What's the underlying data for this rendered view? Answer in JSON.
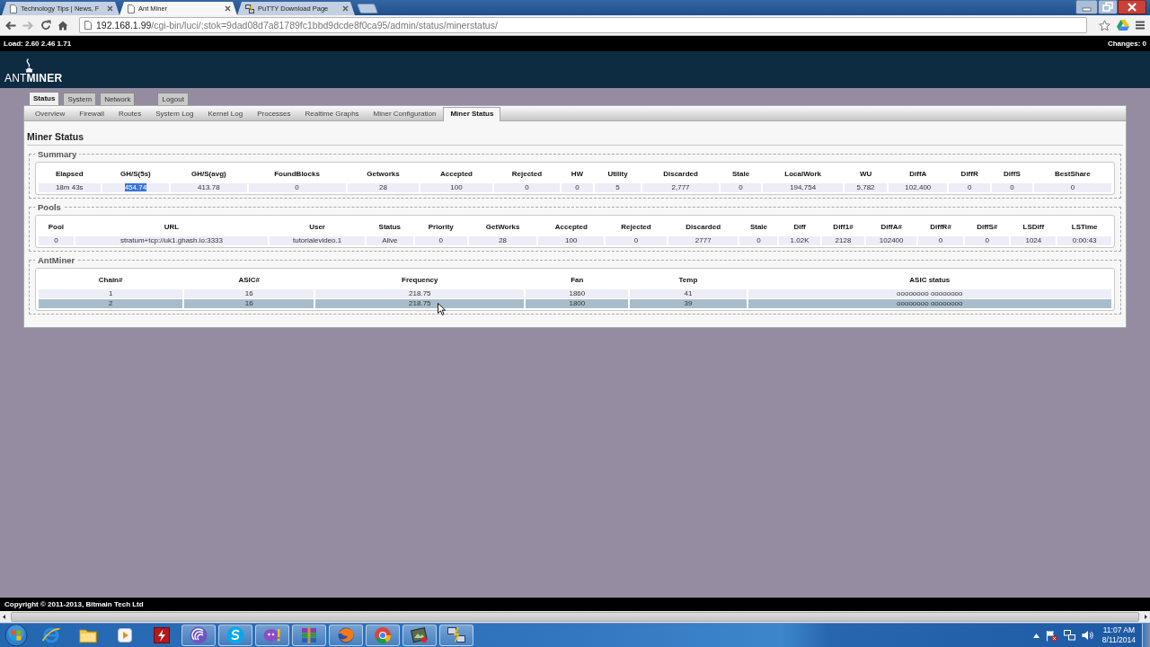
{
  "browser": {
    "tabs": [
      {
        "title": "Technology Tips | News, F",
        "selected": false,
        "kind": "page"
      },
      {
        "title": "Ant Miner",
        "selected": true,
        "kind": "page"
      },
      {
        "title": "PuTTY Download Page",
        "selected": false,
        "kind": "putty"
      }
    ],
    "back": {
      "disabled": false
    },
    "forward": {
      "disabled": true
    },
    "url_host": "192.168.1.99",
    "url_path": "/cgi-bin/luci/;stok=9dad08d7a81789fc1bbd9dcde8f0ca95/admin/status/minerstatus/"
  },
  "status_bar": {
    "load": "Load: 2.60 2.46 1.71",
    "changes": "Changes: 0"
  },
  "logo": "ANT**MINER**",
  "main_tabs": [
    {
      "label": "Status",
      "selected": true
    },
    {
      "label": "System",
      "selected": false
    },
    {
      "label": "Network",
      "selected": false
    }
  ],
  "logout": "Logout",
  "sub_tabs": [
    {
      "label": "Overview",
      "selected": false
    },
    {
      "label": "Firewall",
      "selected": false
    },
    {
      "label": "Routes",
      "selected": false
    },
    {
      "label": "System Log",
      "selected": false
    },
    {
      "label": "Kernel Log",
      "selected": false
    },
    {
      "label": "Processes",
      "selected": false
    },
    {
      "label": "Realtime Graphs",
      "selected": false
    },
    {
      "label": "Miner Configuration",
      "selected": false
    },
    {
      "label": "Miner Status",
      "selected": true
    }
  ],
  "page_title": "Miner Status",
  "sections": [
    {
      "legend": "Summary",
      "columns": [
        "Elapsed",
        "GH/S(5s)",
        "GH/S(avg)",
        "FoundBlocks",
        "Getworks",
        "Accepted",
        "Rejected",
        "HW",
        "Utility",
        "Discarded",
        "Stale",
        "LocalWork",
        "WU",
        "DiffA",
        "DiffR",
        "DiffS",
        "BestShare"
      ],
      "rows": [
        {
          "cells": [
            {
              "text": "18m 43s",
              "text_selected": false
            },
            {
              "text": "454.74",
              "text_selected": true
            },
            {
              "text": "413.78",
              "text_selected": false
            },
            {
              "text": "0",
              "text_selected": false
            },
            {
              "text": "28",
              "text_selected": false
            },
            {
              "text": "100",
              "text_selected": false
            },
            {
              "text": "0",
              "text_selected": false
            },
            {
              "text": "0",
              "text_selected": false
            },
            {
              "text": "5",
              "text_selected": false
            },
            {
              "text": "2,777",
              "text_selected": false
            },
            {
              "text": "0",
              "text_selected": false
            },
            {
              "text": "194,754",
              "text_selected": false
            },
            {
              "text": "5,782",
              "text_selected": false
            },
            {
              "text": "102,400",
              "text_selected": false
            },
            {
              "text": "0",
              "text_selected": false
            },
            {
              "text": "0",
              "text_selected": false
            },
            {
              "text": "0",
              "text_selected": false
            }
          ]
        }
      ]
    },
    {
      "legend": "Pools",
      "columns": [
        "Pool",
        "URL",
        "User",
        "Status",
        "Priority",
        "GetWorks",
        "Accepted",
        "Rejected",
        "Discarded",
        "Stale",
        "Diff",
        "Diff1#",
        "DiffA#",
        "DiffR#",
        "DiffS#",
        "LSDiff",
        "LSTime"
      ],
      "rows": [
        {
          "cells": [
            "0",
            "stratum+tcp://uk1.ghash.io:3333",
            "tutorialevideo.1",
            "Alive",
            "0",
            "28",
            "100",
            "0",
            "2777",
            "0",
            "1.02K",
            "2128",
            "102400",
            "0",
            "0",
            "1024",
            "0:00:43"
          ]
        }
      ]
    },
    {
      "legend": "AntMiner",
      "columns": [
        "Chain#",
        "ASIC#",
        "Frequency",
        "Fan",
        "Temp",
        "ASIC status"
      ],
      "rows": [
        {
          "hovered": false,
          "cells": [
            "1",
            "16",
            "218.75",
            "1860",
            "41",
            "oooooooo oooooooo"
          ]
        },
        {
          "hovered": true,
          "cells": [
            "2",
            "16",
            "218.75",
            "1800",
            "39",
            "oooooooo oooooooo"
          ]
        }
      ]
    }
  ],
  "footer": "Copyright © 2011-2013, Bitmain Tech Ltd",
  "taskbar": {
    "apps": [
      {
        "kind": "ebrowser",
        "running": false
      },
      {
        "kind": "folder",
        "running": false
      },
      {
        "kind": "player",
        "running": false
      },
      {
        "kind": "bolttile",
        "running": false
      },
      {
        "kind": "rings",
        "running": true
      },
      {
        "kind": "chat",
        "running": true
      },
      {
        "kind": "messenger",
        "running": true
      },
      {
        "kind": "books",
        "running": true
      },
      {
        "kind": "foxglobe",
        "running": true
      },
      {
        "kind": "wheel",
        "running": true
      },
      {
        "kind": "picture",
        "running": true
      },
      {
        "kind": "computers",
        "running": true
      }
    ],
    "time": "11:07 AM",
    "date": "8/11/2014"
  }
}
